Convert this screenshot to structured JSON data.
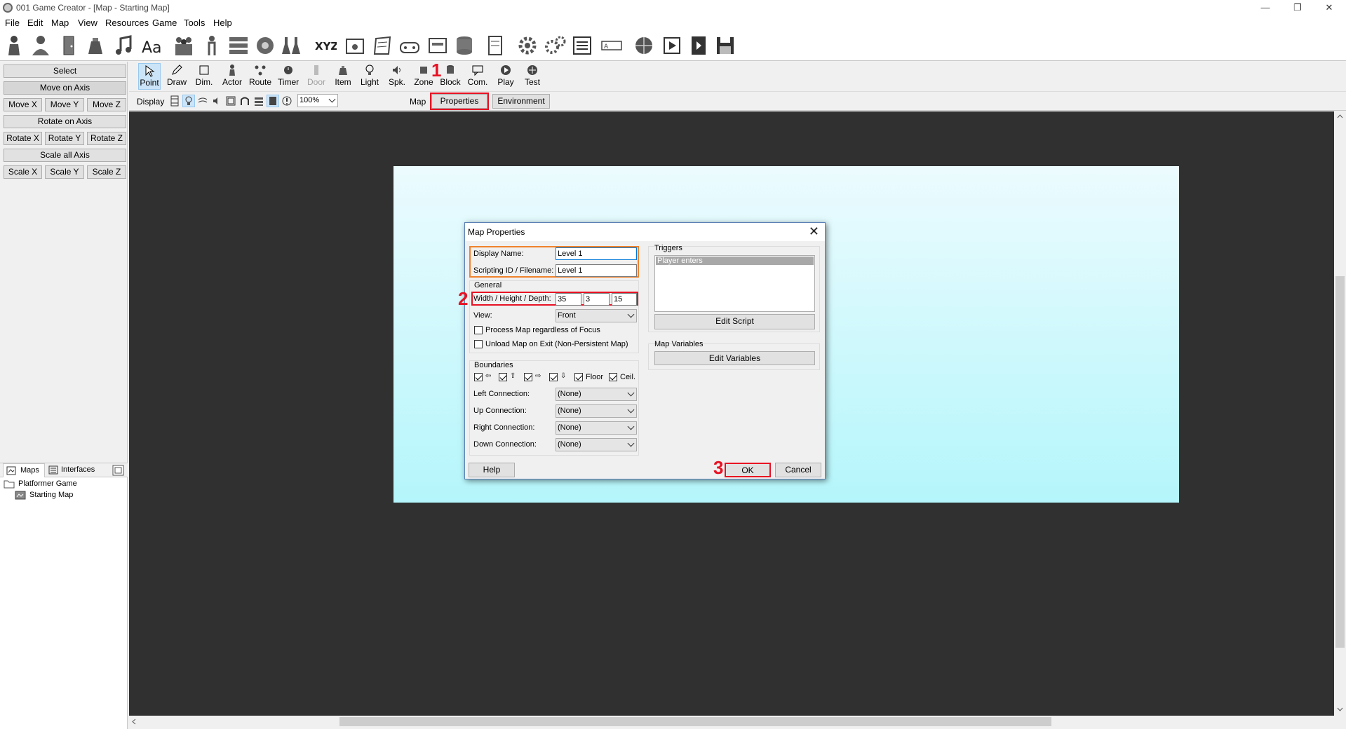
{
  "window": {
    "title": "001 Game Creator - [Map - Starting Map]",
    "minimize": "—",
    "restore": "❐",
    "close": "✕"
  },
  "menu": [
    "File",
    "Edit",
    "Map",
    "View",
    "Resources",
    "Game",
    "Tools",
    "Help"
  ],
  "left_panel": {
    "select": "Select",
    "move_on_axis": "Move on Axis",
    "move_x": "Move X",
    "move_y": "Move Y",
    "move_z": "Move Z",
    "rotate_on_axis": "Rotate on Axis",
    "rotate_x": "Rotate X",
    "rotate_y": "Rotate Y",
    "rotate_z": "Rotate Z",
    "scale_all_axis": "Scale all Axis",
    "scale_x": "Scale X",
    "scale_y": "Scale Y",
    "scale_z": "Scale Z"
  },
  "tools": [
    "Point",
    "Draw",
    "Dim.",
    "Actor",
    "Route",
    "Timer",
    "Door",
    "Item",
    "Light",
    "Spk.",
    "Zone",
    "Block",
    "Com.",
    "Play",
    "Test"
  ],
  "display_strip": {
    "label": "Display",
    "zoom": "100%",
    "map_label": "Map",
    "properties": "Properties",
    "environment": "Environment"
  },
  "markers": {
    "one": "1",
    "two": "2",
    "three": "3"
  },
  "tree": {
    "tab_maps": "Maps",
    "tab_interfaces": "Interfaces",
    "root": "Platformer Game",
    "child": "Starting Map"
  },
  "dialog": {
    "title": "Map Properties",
    "display_name_label": "Display Name:",
    "display_name_value": "Level 1",
    "scripting_id_label": "Scripting ID / Filename:",
    "scripting_id_value": "Level 1",
    "general": "General",
    "whd_label": "Width / Height / Depth:",
    "width": "35",
    "height": "3",
    "depth": "15",
    "view_label": "View:",
    "view_value": "Front",
    "process_map": "Process Map regardless of Focus",
    "unload_map": "Unload Map on Exit (Non-Persistent Map)",
    "boundaries": "Boundaries",
    "floor": "Floor",
    "ceil": "Ceil.",
    "left_conn_label": "Left Connection:",
    "up_conn_label": "Up Connection:",
    "right_conn_label": "Right Connection:",
    "down_conn_label": "Down Connection:",
    "conn_value": "(None)",
    "triggers": "Triggers",
    "trigger_item": "Player enters",
    "edit_script": "Edit Script",
    "map_variables": "Map Variables",
    "edit_variables": "Edit Variables",
    "help": "Help",
    "ok": "OK",
    "cancel": "Cancel"
  },
  "colors": {
    "highlight_red": "#e81123",
    "highlight_orange": "#f0822c",
    "viewport": "#303030"
  }
}
